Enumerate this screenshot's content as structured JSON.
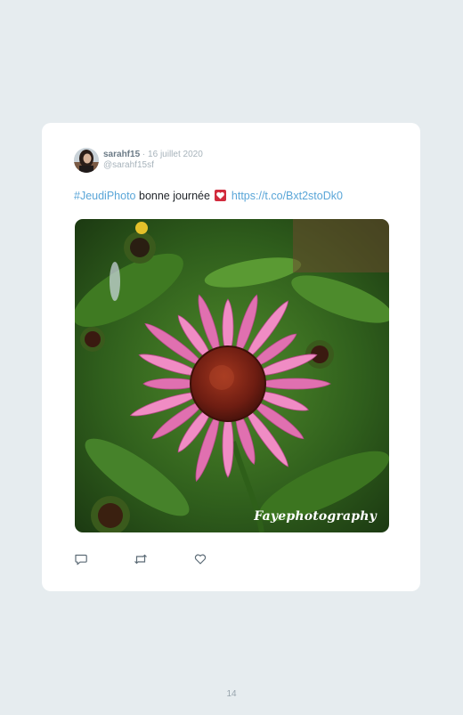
{
  "post": {
    "username": "sarahf15",
    "separator": "·",
    "date": "16 juillet 2020",
    "handle": "@sarahf15sf",
    "hashtag": "#JeudiPhoto",
    "text_body": "bonne journée",
    "link": "https://t.co/Bxt2stoDk0",
    "watermark": "Fayephotography"
  },
  "actions": {
    "icons": [
      "reply-icon",
      "retweet-icon",
      "like-icon"
    ]
  },
  "footer": {
    "page_number": "14"
  },
  "colors": {
    "background": "#e6ecef",
    "card": "#ffffff",
    "link": "#5aa6d8",
    "heart": "#d12b3d"
  }
}
